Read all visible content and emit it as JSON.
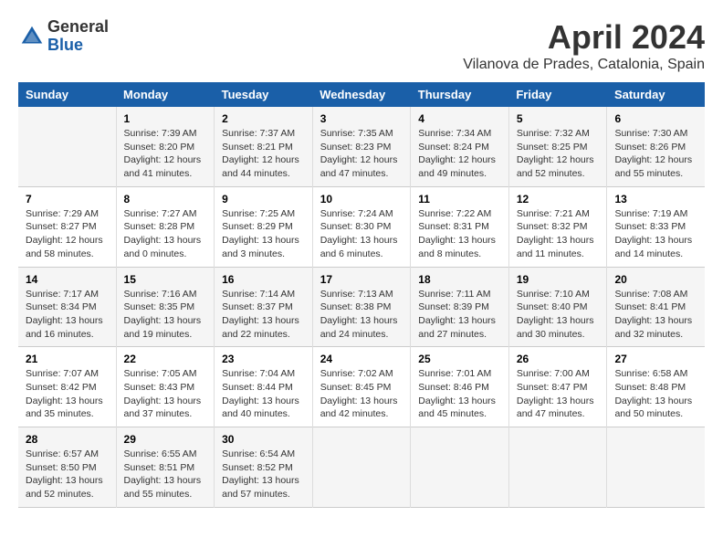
{
  "logo": {
    "line1": "General",
    "line2": "Blue"
  },
  "title": "April 2024",
  "subtitle": "Vilanova de Prades, Catalonia, Spain",
  "weekdays": [
    "Sunday",
    "Monday",
    "Tuesday",
    "Wednesday",
    "Thursday",
    "Friday",
    "Saturday"
  ],
  "weeks": [
    [
      {
        "day": "",
        "info": ""
      },
      {
        "day": "1",
        "info": "Sunrise: 7:39 AM\nSunset: 8:20 PM\nDaylight: 12 hours\nand 41 minutes."
      },
      {
        "day": "2",
        "info": "Sunrise: 7:37 AM\nSunset: 8:21 PM\nDaylight: 12 hours\nand 44 minutes."
      },
      {
        "day": "3",
        "info": "Sunrise: 7:35 AM\nSunset: 8:23 PM\nDaylight: 12 hours\nand 47 minutes."
      },
      {
        "day": "4",
        "info": "Sunrise: 7:34 AM\nSunset: 8:24 PM\nDaylight: 12 hours\nand 49 minutes."
      },
      {
        "day": "5",
        "info": "Sunrise: 7:32 AM\nSunset: 8:25 PM\nDaylight: 12 hours\nand 52 minutes."
      },
      {
        "day": "6",
        "info": "Sunrise: 7:30 AM\nSunset: 8:26 PM\nDaylight: 12 hours\nand 55 minutes."
      }
    ],
    [
      {
        "day": "7",
        "info": "Sunrise: 7:29 AM\nSunset: 8:27 PM\nDaylight: 12 hours\nand 58 minutes."
      },
      {
        "day": "8",
        "info": "Sunrise: 7:27 AM\nSunset: 8:28 PM\nDaylight: 13 hours\nand 0 minutes."
      },
      {
        "day": "9",
        "info": "Sunrise: 7:25 AM\nSunset: 8:29 PM\nDaylight: 13 hours\nand 3 minutes."
      },
      {
        "day": "10",
        "info": "Sunrise: 7:24 AM\nSunset: 8:30 PM\nDaylight: 13 hours\nand 6 minutes."
      },
      {
        "day": "11",
        "info": "Sunrise: 7:22 AM\nSunset: 8:31 PM\nDaylight: 13 hours\nand 8 minutes."
      },
      {
        "day": "12",
        "info": "Sunrise: 7:21 AM\nSunset: 8:32 PM\nDaylight: 13 hours\nand 11 minutes."
      },
      {
        "day": "13",
        "info": "Sunrise: 7:19 AM\nSunset: 8:33 PM\nDaylight: 13 hours\nand 14 minutes."
      }
    ],
    [
      {
        "day": "14",
        "info": "Sunrise: 7:17 AM\nSunset: 8:34 PM\nDaylight: 13 hours\nand 16 minutes."
      },
      {
        "day": "15",
        "info": "Sunrise: 7:16 AM\nSunset: 8:35 PM\nDaylight: 13 hours\nand 19 minutes."
      },
      {
        "day": "16",
        "info": "Sunrise: 7:14 AM\nSunset: 8:37 PM\nDaylight: 13 hours\nand 22 minutes."
      },
      {
        "day": "17",
        "info": "Sunrise: 7:13 AM\nSunset: 8:38 PM\nDaylight: 13 hours\nand 24 minutes."
      },
      {
        "day": "18",
        "info": "Sunrise: 7:11 AM\nSunset: 8:39 PM\nDaylight: 13 hours\nand 27 minutes."
      },
      {
        "day": "19",
        "info": "Sunrise: 7:10 AM\nSunset: 8:40 PM\nDaylight: 13 hours\nand 30 minutes."
      },
      {
        "day": "20",
        "info": "Sunrise: 7:08 AM\nSunset: 8:41 PM\nDaylight: 13 hours\nand 32 minutes."
      }
    ],
    [
      {
        "day": "21",
        "info": "Sunrise: 7:07 AM\nSunset: 8:42 PM\nDaylight: 13 hours\nand 35 minutes."
      },
      {
        "day": "22",
        "info": "Sunrise: 7:05 AM\nSunset: 8:43 PM\nDaylight: 13 hours\nand 37 minutes."
      },
      {
        "day": "23",
        "info": "Sunrise: 7:04 AM\nSunset: 8:44 PM\nDaylight: 13 hours\nand 40 minutes."
      },
      {
        "day": "24",
        "info": "Sunrise: 7:02 AM\nSunset: 8:45 PM\nDaylight: 13 hours\nand 42 minutes."
      },
      {
        "day": "25",
        "info": "Sunrise: 7:01 AM\nSunset: 8:46 PM\nDaylight: 13 hours\nand 45 minutes."
      },
      {
        "day": "26",
        "info": "Sunrise: 7:00 AM\nSunset: 8:47 PM\nDaylight: 13 hours\nand 47 minutes."
      },
      {
        "day": "27",
        "info": "Sunrise: 6:58 AM\nSunset: 8:48 PM\nDaylight: 13 hours\nand 50 minutes."
      }
    ],
    [
      {
        "day": "28",
        "info": "Sunrise: 6:57 AM\nSunset: 8:50 PM\nDaylight: 13 hours\nand 52 minutes."
      },
      {
        "day": "29",
        "info": "Sunrise: 6:55 AM\nSunset: 8:51 PM\nDaylight: 13 hours\nand 55 minutes."
      },
      {
        "day": "30",
        "info": "Sunrise: 6:54 AM\nSunset: 8:52 PM\nDaylight: 13 hours\nand 57 minutes."
      },
      {
        "day": "",
        "info": ""
      },
      {
        "day": "",
        "info": ""
      },
      {
        "day": "",
        "info": ""
      },
      {
        "day": "",
        "info": ""
      }
    ]
  ]
}
